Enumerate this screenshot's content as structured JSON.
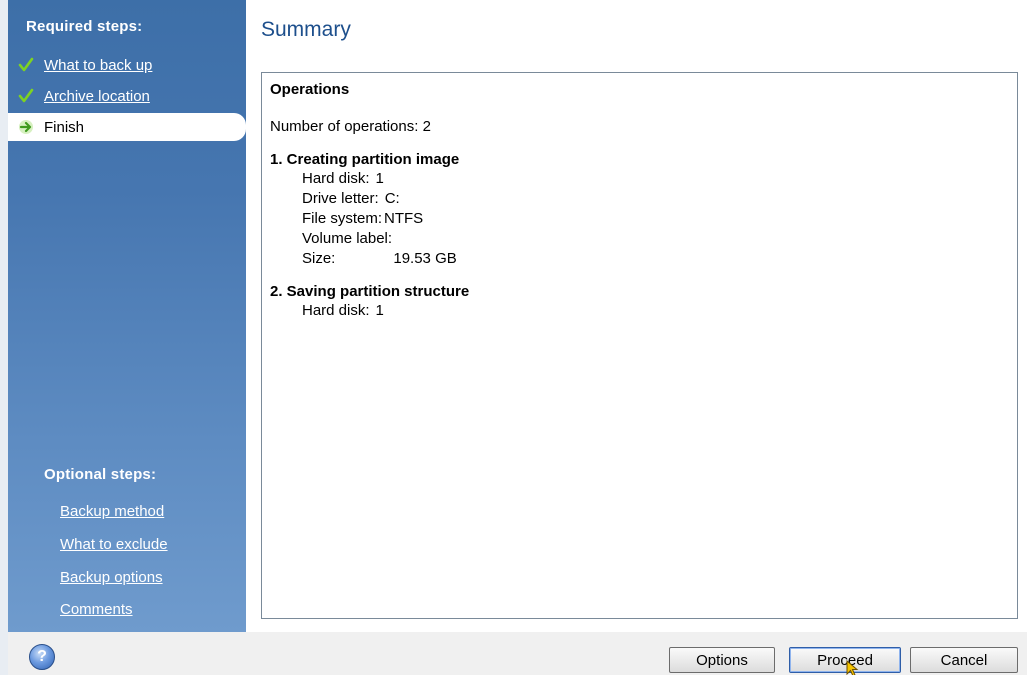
{
  "sidebar": {
    "required_heading": "Required steps:",
    "required_steps": [
      {
        "label": "What to back up",
        "state": "done"
      },
      {
        "label": "Archive location",
        "state": "done"
      },
      {
        "label": "Finish",
        "state": "current"
      }
    ],
    "optional_heading": "Optional steps:",
    "optional_steps": [
      {
        "label": "Backup method"
      },
      {
        "label": "What to exclude"
      },
      {
        "label": "Backup options"
      },
      {
        "label": "Comments"
      }
    ]
  },
  "main": {
    "title": "Summary",
    "summary": {
      "heading": "Operations",
      "count_text": "Number of operations: 2",
      "op1": {
        "title": "1. Creating partition image",
        "rows": [
          {
            "key": "Hard disk:",
            "value": "1"
          },
          {
            "key": "Drive letter:",
            "value": "C:"
          },
          {
            "key": "File system:",
            "value": "NTFS"
          },
          {
            "key": "Volume label:",
            "value": ""
          },
          {
            "key": "Size:",
            "value": "19.53 GB"
          }
        ]
      },
      "op2": {
        "title": "2. Saving partition structure",
        "rows": [
          {
            "key": "Hard disk:",
            "value": "1"
          }
        ]
      }
    }
  },
  "footer": {
    "options_label": "Options",
    "proceed_label": "Proceed",
    "cancel_label": "Cancel",
    "help_icon": "help-icon"
  },
  "colors": {
    "sidebar": "#4676b0",
    "title": "#1d4f8c",
    "check": "#7ed321",
    "arrow": "#5bb02a"
  }
}
